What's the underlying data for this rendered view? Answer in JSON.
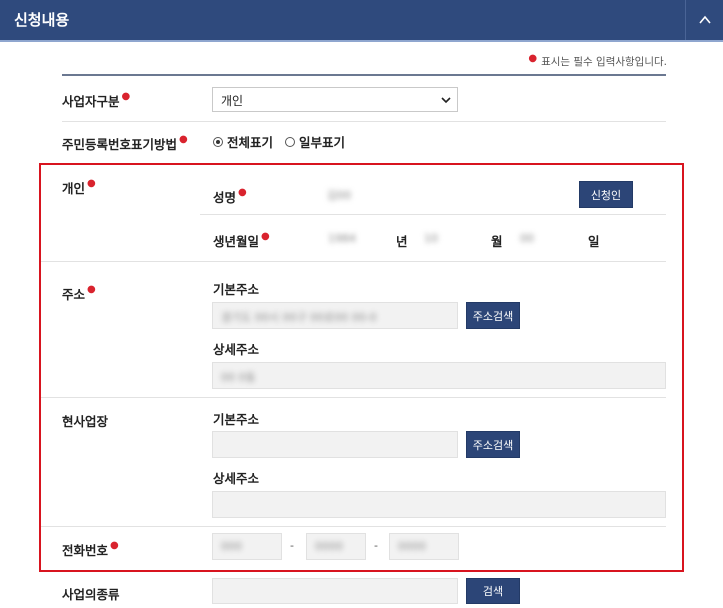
{
  "header": {
    "title": "신청내용"
  },
  "note": {
    "text": "표시는 필수 입력사항입니다."
  },
  "rows": {
    "business_type": {
      "label": "사업자구분",
      "selected": "개인"
    },
    "rrn_display": {
      "label": "주민등록번호표기방법",
      "options": [
        "전체표기",
        "일부표기"
      ]
    },
    "personal": {
      "label": "개인",
      "name_label": "성명",
      "name_value": "김00",
      "applicant_button": "신청인",
      "birth_label": "생년월일",
      "birth_year": "1984",
      "year_unit": "년",
      "birth_month": "10",
      "month_unit": "월",
      "birth_day": "00",
      "day_unit": "일"
    },
    "address": {
      "label": "주소",
      "basic_label": "기본주소",
      "basic_value": "경기도 00시 00구 00로00 00-0",
      "search_button": "주소검색",
      "detail_label": "상세주소",
      "detail_value": "00 0동"
    },
    "workplace": {
      "label": "현사업장",
      "basic_label": "기본주소",
      "search_button": "주소검색",
      "detail_label": "상세주소"
    },
    "phone": {
      "label": "전화번호",
      "part1": "000",
      "part2": "0000",
      "part3": "0000",
      "sep": "-"
    },
    "business_kind": {
      "label": "사업의종류",
      "search_button": "검색"
    }
  },
  "colors": {
    "header_bg": "#2f4a7d",
    "button_bg": "#2c4577",
    "required": "#d9232e",
    "highlight_border": "#d8141f"
  }
}
